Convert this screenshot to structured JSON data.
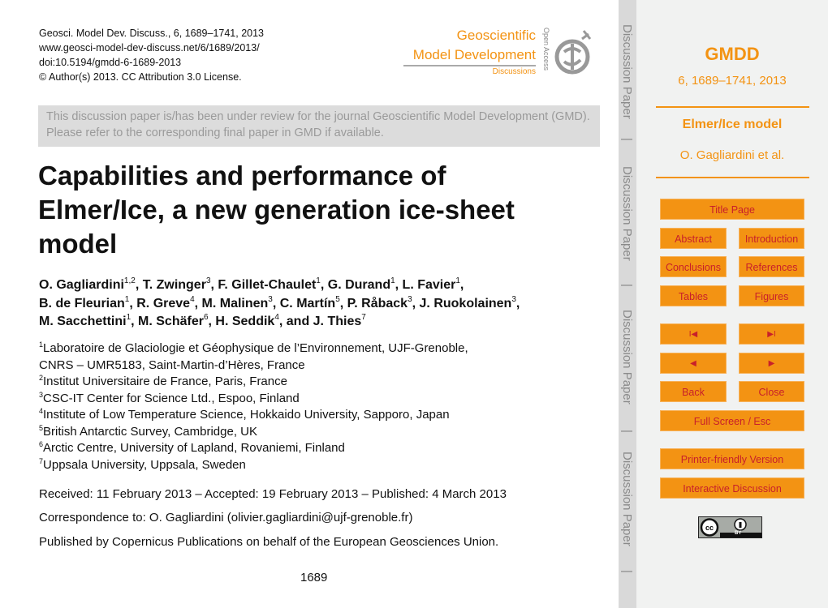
{
  "header": {
    "citation": "Geosci. Model Dev. Discuss., 6, 1689–1741, 2013",
    "url": "www.geosci-model-dev-discuss.net/6/1689/2013/",
    "doi": "doi:10.5194/gmdd-6-1689-2013",
    "license": "© Author(s) 2013. CC Attribution 3.0 License."
  },
  "logo": {
    "line1": "Geoscientific",
    "line2": "Model Development",
    "line3": "Discussions",
    "open_access": "Open Access"
  },
  "notice": "This discussion paper is/has been under review for the journal Geoscientific Model Development (GMD). Please refer to the corresponding final paper in GMD if available.",
  "title_lines": [
    "Capabilities and performance of",
    "Elmer/Ice, a new generation ice-sheet",
    "model"
  ],
  "authors": [
    [
      {
        "n": "O. Gagliardini",
        "s": "1,2",
        "p": ", "
      },
      {
        "n": "T. Zwinger",
        "s": "3",
        "p": ", "
      },
      {
        "n": "F. Gillet-Chaulet",
        "s": "1",
        "p": ", "
      },
      {
        "n": "G. Durand",
        "s": "1",
        "p": ", "
      },
      {
        "n": "L. Favier",
        "s": "1",
        "p": ","
      }
    ],
    [
      {
        "n": "B. de Fleurian",
        "s": "1",
        "p": ", "
      },
      {
        "n": "R. Greve",
        "s": "4",
        "p": ", "
      },
      {
        "n": "M. Malinen",
        "s": "3",
        "p": ", "
      },
      {
        "n": "C. Martín",
        "s": "5",
        "p": ", "
      },
      {
        "n": "P. Råback",
        "s": "3",
        "p": ", "
      },
      {
        "n": "J. Ruokolainen",
        "s": "3",
        "p": ","
      }
    ],
    [
      {
        "n": "M. Sacchettini",
        "s": "1",
        "p": ", "
      },
      {
        "n": "M. Schäfer",
        "s": "6",
        "p": ", "
      },
      {
        "n": "H. Seddik",
        "s": "4",
        "p": ", and "
      },
      {
        "n": "J. Thies",
        "s": "7",
        "p": ""
      }
    ]
  ],
  "affiliations": [
    {
      "s": "1",
      "t": "Laboratoire de Glaciologie et Géophysique de l’Environnement, UJF-Grenoble,"
    },
    {
      "s": "",
      "t": "CNRS – UMR5183, Saint-Martin-d’Hères, France"
    },
    {
      "s": "2",
      "t": "Institut Universitaire de France, Paris, France"
    },
    {
      "s": "3",
      "t": "CSC-IT Center for Science Ltd., Espoo, Finland"
    },
    {
      "s": "4",
      "t": "Institute of Low Temperature Science, Hokkaido University, Sapporo, Japan"
    },
    {
      "s": "5",
      "t": "British Antarctic Survey, Cambridge, UK"
    },
    {
      "s": "6",
      "t": "Arctic Centre, University of Lapland, Rovaniemi, Finland"
    },
    {
      "s": "7",
      "t": "Uppsala University, Uppsala, Sweden"
    }
  ],
  "received": "Received: 11 February 2013 – Accepted: 19 February 2013 – Published: 4 March 2013",
  "correspondence": "Correspondence to: O. Gagliardini (olivier.gagliardini@ujf-grenoble.fr)",
  "publisher": "Published by Copernicus Publications on behalf of the European Geosciences Union.",
  "page_number": "1689",
  "strip": {
    "label": "Discussion Paper",
    "separator": "|"
  },
  "sidebar": {
    "journal": "GMDD",
    "volume": "6, 1689–1741, 2013",
    "short_title": "Elmer/Ice model",
    "short_authors": "O. Gagliardini et al.",
    "buttons": {
      "title_page": "Title Page",
      "abstract": "Abstract",
      "introduction": "Introduction",
      "conclusions": "Conclusions",
      "references": "References",
      "tables": "Tables",
      "figures": "Figures",
      "first": "I◀",
      "last": "▶I",
      "prev": "◀",
      "next": "▶",
      "back": "Back",
      "close": "Close",
      "fullscreen": "Full Screen / Esc",
      "printer": "Printer-friendly Version",
      "interactive": "Interactive Discussion"
    },
    "cc_badge": "BY"
  },
  "colors": {
    "accent": "#f39313",
    "button_text": "#c8202a",
    "panel_bg": "#f1f2f1"
  }
}
